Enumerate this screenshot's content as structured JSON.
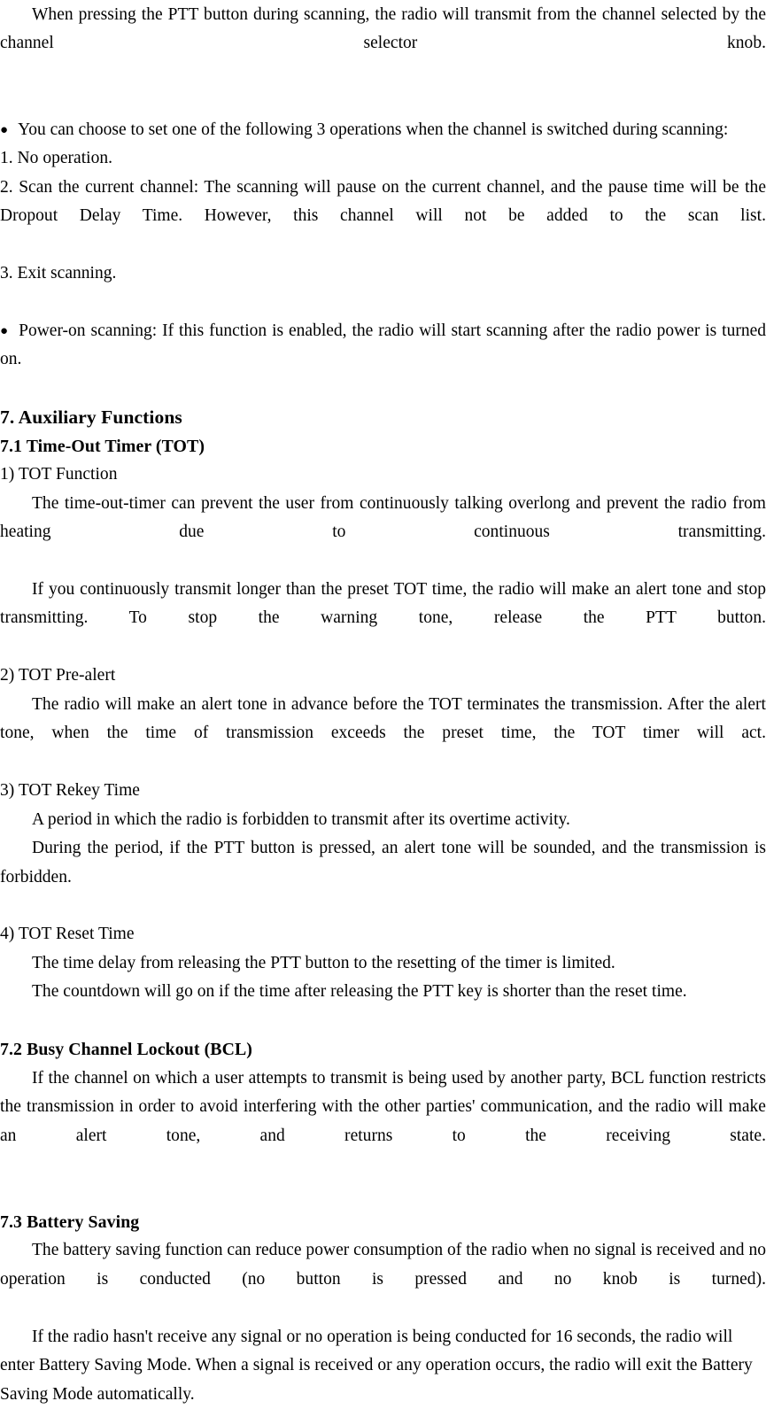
{
  "document": {
    "type": "two-way-radio-user-manual-page",
    "body_font": "serif",
    "text_color": "#000000",
    "background_color": "#ffffff",
    "bullet_glyph": "●"
  },
  "paragraphs": {
    "ptt_scanning": "When pressing the PTT button during scanning, the radio will transmit from the channel selected by the channel selector knob.",
    "channel_switch_intro": "You can choose to set one of the following 3 operations when the channel is switched during scanning:",
    "list_item_1": "1. No operation.",
    "list_item_2": "2. Scan the current channel: The scanning will pause on the current channel, and the pause time will be the Dropout Delay Time. However, this channel will not be added to the scan list.",
    "list_item_3": "3. Exit scanning.",
    "power_on_scanning": "Power-on scanning: If this function is enabled, the radio will start scanning after the radio power is turned on."
  },
  "section_7": {
    "heading": "7. Auxiliary Functions",
    "sub_7_1": {
      "heading": "7.1 Time-Out Timer (TOT)",
      "item_1_label": "1) TOT Function",
      "item_1_body_a": "The time-out-timer can prevent the user from continuously talking overlong and prevent the radio from heating due to continuous transmitting.",
      "item_1_body_b": "If you continuously transmit longer than the preset TOT time, the radio will make an alert tone and stop transmitting. To stop the warning tone, release the PTT button.",
      "item_2_label": "2) TOT Pre-alert",
      "item_2_body": "The radio will make an alert tone in advance before the TOT terminates the transmission. After the alert tone, when the time of transmission exceeds the preset time, the TOT timer will act.",
      "item_3_label": "3) TOT Rekey Time",
      "item_3_body_a": "A period in which the radio is forbidden to transmit after its overtime activity.",
      "item_3_body_b": "During the period, if the PTT button is pressed, an alert tone will be sounded, and the transmission is forbidden.",
      "item_4_label": "4) TOT Reset Time",
      "item_4_body_a": "The time delay from releasing the PTT button to the resetting of the timer is limited.",
      "item_4_body_b": "The countdown will go on if the time after releasing the PTT key is shorter than the reset time."
    },
    "sub_7_2": {
      "heading": "7.2 Busy Channel Lockout (BCL)",
      "body": "If the channel on which a user attempts to transmit is being used by another party, BCL function restricts the transmission in order to avoid interfering with the other parties' communication, and the radio will make an alert tone, and returns to the receiving state."
    },
    "sub_7_3": {
      "heading": "7.3 Battery Saving",
      "body_a": "The battery saving function can reduce power consumption of the radio when no signal is received and no operation is conducted (no button is pressed and no knob is turned).",
      "body_b": "If the radio hasn't receive any signal or no operation is being conducted for 16 seconds, the radio will enter Battery Saving Mode. When a signal is received or any operation occurs, the radio will exit the Battery Saving Mode automatically."
    }
  }
}
